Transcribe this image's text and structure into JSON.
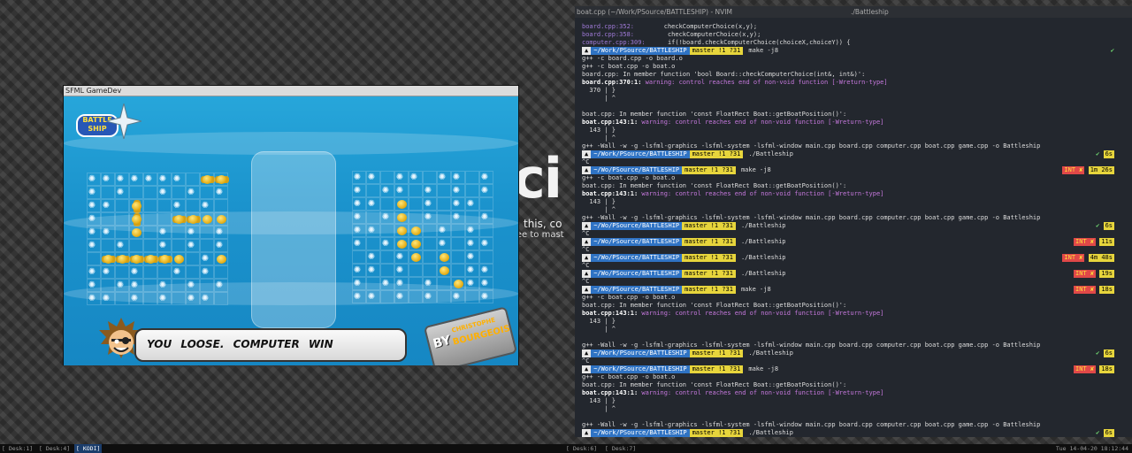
{
  "desktop": {
    "bg_logo": "ci",
    "bg_tagline": "this, co",
    "bg_tagline2": "ree to mast"
  },
  "sfml_window": {
    "title": "SFML GameDev",
    "logo_text": "BATTLE SHIP",
    "banner_text": "YOU LOOSE. COMPUTER WIN",
    "sign_by": "BY",
    "sign_name1": "CHRISTOPHE",
    "sign_name2": "BOURGEOIS"
  },
  "terminal": {
    "title_left": "boat.cpp (~/Work/PSource/BATTLESHIP) - NVIM",
    "title_right": "./Battleship",
    "grep_lines": [
      {
        "file": "board.cpp:352:",
        "code": "        checkComputerChoice(x,y);"
      },
      {
        "file": "board.cpp:358:",
        "code": "         checkComputerChoice(x,y);"
      },
      {
        "file": "computer.cpp:309:",
        "code": "      if(!board.checkComputerChoice(choiceX,choiceY)) {"
      }
    ],
    "lines": [
      {
        "type": "prompt",
        "path": "~/Work/PSource/BATTLESHIP",
        "git": "master !1 ?31",
        "cmd": "make -j8",
        "status": "✔"
      },
      {
        "type": "text",
        "text": "g++ -c board.cpp -o board.o"
      },
      {
        "type": "text",
        "text": "g++ -c boat.cpp -o boat.o"
      },
      {
        "type": "text",
        "text": "board.cpp: In member function 'bool Board::checkComputerChoice(int&, int&)':"
      },
      {
        "type": "warn",
        "loc": "board.cpp:370:1:",
        "msg": " warning: control reaches end of non-void function [-Wreturn-type]"
      },
      {
        "type": "text",
        "text": "  370 | }"
      },
      {
        "type": "text",
        "text": "      | ^"
      },
      {
        "type": "text",
        "text": ""
      },
      {
        "type": "text",
        "text": "boat.cpp: In member function 'const FloatRect Boat::getBoatPosition()':"
      },
      {
        "type": "warn",
        "loc": "boat.cpp:143:1:",
        "msg": " warning: control reaches end of non-void function [-Wreturn-type]"
      },
      {
        "type": "text",
        "text": "  143 | }"
      },
      {
        "type": "text",
        "text": "      | ^"
      },
      {
        "type": "text",
        "text": "g++ -Wall -w -g -lsfml-graphics -lsfml-system -lsfml-window main.cpp board.cpp computer.cpp boat.cpp game.cpp -o Battleship"
      },
      {
        "type": "prompt",
        "path": "~/Work/PSource/BATTLESHIP",
        "git": "master !1 ?31",
        "cmd": "./Battleship",
        "status": "✔",
        "time": "6s"
      },
      {
        "type": "text",
        "text": "^C"
      },
      {
        "type": "prompt",
        "path": "~/Wo/PSource/BATTLESHIP",
        "git": "master !1 ?31",
        "cmd": "make -j8",
        "status": "INT ✘",
        "time": "1m 26s"
      },
      {
        "type": "text",
        "text": "g++ -c boat.cpp -o boat.o"
      },
      {
        "type": "text",
        "text": "boat.cpp: In member function 'const FloatRect Boat::getBoatPosition()':"
      },
      {
        "type": "warn",
        "loc": "boat.cpp:143:1:",
        "msg": " warning: control reaches end of non-void function [-Wreturn-type]"
      },
      {
        "type": "text",
        "text": "  143 | }"
      },
      {
        "type": "text",
        "text": "      | ^"
      },
      {
        "type": "text",
        "text": "g++ -Wall -w -g -lsfml-graphics -lsfml-system -lsfml-window main.cpp board.cpp computer.cpp boat.cpp game.cpp -o Battleship"
      },
      {
        "type": "prompt",
        "path": "~/Wo/PSource/BATTLESHIP",
        "git": "master !1 ?31",
        "cmd": "./Battleship",
        "status": "✔",
        "time": "6s"
      },
      {
        "type": "text",
        "text": "^C"
      },
      {
        "type": "prompt",
        "path": "~/Wo/PSource/BATTLESHIP",
        "git": "master !1 ?31",
        "cmd": "./Battleship",
        "status": "INT ✘",
        "time": "11s"
      },
      {
        "type": "text",
        "text": "^C"
      },
      {
        "type": "prompt",
        "path": "~/Wo/PSource/BATTLESHIP",
        "git": "master !1 ?31",
        "cmd": "./Battleship",
        "status": "INT ✘",
        "time": "4m 48s"
      },
      {
        "type": "text",
        "text": "^C"
      },
      {
        "type": "prompt",
        "path": "~/Wo/PSource/BATTLESHIP",
        "git": "master !1 ?31",
        "cmd": "./Battleship",
        "status": "INT ✘",
        "time": "19s"
      },
      {
        "type": "text",
        "text": "^C"
      },
      {
        "type": "prompt",
        "path": "~/Wo/PSource/BATTLESHIP",
        "git": "master !1 ?31",
        "cmd": "make -j8",
        "status": "INT ✘",
        "time": "18s"
      },
      {
        "type": "text",
        "text": "g++ -c boat.cpp -o boat.o"
      },
      {
        "type": "text",
        "text": "boat.cpp: In member function 'const FloatRect Boat::getBoatPosition()':"
      },
      {
        "type": "warn",
        "loc": "boat.cpp:143:1:",
        "msg": " warning: control reaches end of non-void function [-Wreturn-type]"
      },
      {
        "type": "text",
        "text": "  143 | }"
      },
      {
        "type": "text",
        "text": "      | ^"
      },
      {
        "type": "text",
        "text": ""
      },
      {
        "type": "text",
        "text": "g++ -Wall -w -g -lsfml-graphics -lsfml-system -lsfml-window main.cpp board.cpp computer.cpp boat.cpp game.cpp -o Battleship"
      },
      {
        "type": "prompt",
        "path": "~/Work/PSource/BATTLESHIP",
        "git": "master !1 ?31",
        "cmd": "./Battleship",
        "status": "✔",
        "time": "6s"
      },
      {
        "type": "text",
        "text": "^C"
      },
      {
        "type": "prompt",
        "path": "~/Work/PSource/BATTLESHIP",
        "git": "master !1 ?31",
        "cmd": "make -j8",
        "status": "INT ✘",
        "time": "18s"
      },
      {
        "type": "text",
        "text": "g++ -c boat.cpp -o boat.o"
      },
      {
        "type": "text",
        "text": "boat.cpp: In member function 'const FloatRect Boat::getBoatPosition()':"
      },
      {
        "type": "warn",
        "loc": "boat.cpp:143:1:",
        "msg": " warning: control reaches end of non-void function [-Wreturn-type]"
      },
      {
        "type": "text",
        "text": "  143 | }"
      },
      {
        "type": "text",
        "text": "      | ^"
      },
      {
        "type": "text",
        "text": ""
      },
      {
        "type": "text",
        "text": "g++ -Wall -w -g -lsfml-graphics -lsfml-system -lsfml-window main.cpp board.cpp computer.cpp boat.cpp game.cpp -o Battleship"
      },
      {
        "type": "prompt",
        "path": "~/Work/PSource/BATTLESHIP",
        "git": "master !1 ?31",
        "cmd": "./Battleship",
        "status": "✔",
        "time": "6s"
      },
      {
        "type": "text",
        "text": ""
      }
    ]
  },
  "taskbar": {
    "desk1": "[ Desk:1]",
    "desk4": "[ Desk:4]",
    "kodi": "[ KODI]",
    "desk6": "[ Desk:6]",
    "desk7": "[ Desk:7]",
    "clock": "Tue 14-04-20 18:12:44"
  },
  "colors": {
    "accent_blue": "#2f73c4",
    "git_yellow": "#e7d53c",
    "error_red": "#e04848",
    "ok_green": "#6fd36f"
  }
}
